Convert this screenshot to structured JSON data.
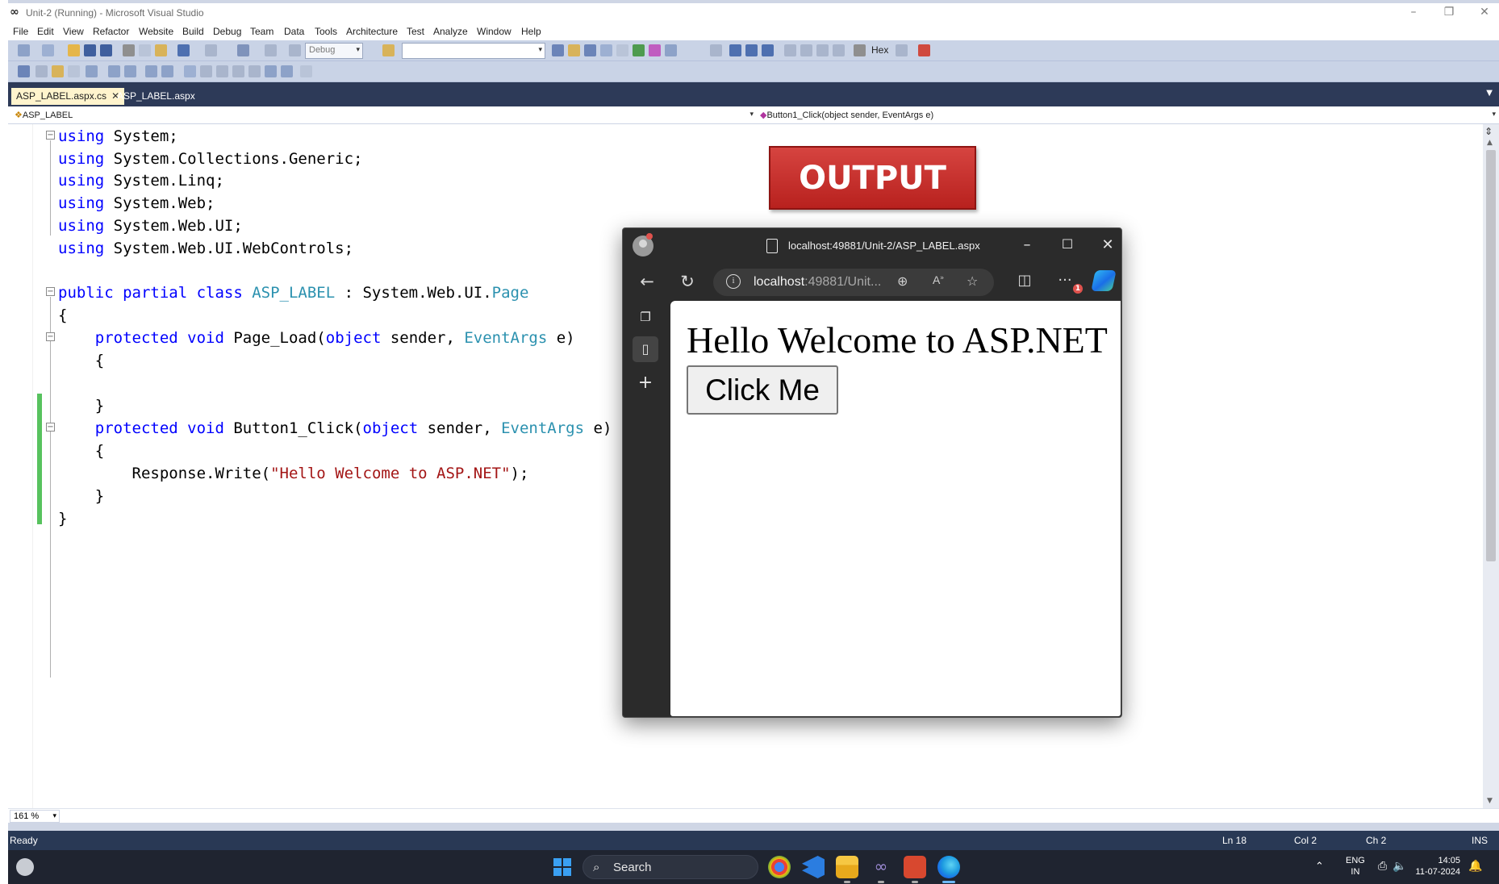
{
  "window": {
    "title": "Unit-2 (Running) - Microsoft Visual Studio",
    "minimize": "–",
    "restore": "❐",
    "close": "✕"
  },
  "menu": [
    "File",
    "Edit",
    "View",
    "Refactor",
    "Website",
    "Build",
    "Debug",
    "Team",
    "Data",
    "Tools",
    "Architecture",
    "Test",
    "Analyze",
    "Window",
    "Help"
  ],
  "toolbar": {
    "config": "Debug",
    "platform": "",
    "hex_label": "Hex"
  },
  "tabs": [
    {
      "label": "ASP_LABEL.aspx.cs",
      "active": true
    },
    {
      "label": "ASP_LABEL.aspx",
      "active": false
    }
  ],
  "navbar": {
    "class_combo": "ASP_LABEL",
    "member_combo": "Button1_Click(object sender, EventArgs e)"
  },
  "code": {
    "line1": "using System;",
    "line2": "using System.Collections.Generic;",
    "line3": "using System.Linq;",
    "line4": "using System.Web;",
    "line5": "using System.Web.UI;",
    "line6": "using System.Web.UI.WebControls;",
    "class_kw": "public partial class ",
    "class_name": "ASP_LABEL",
    "class_sep": " : System.Web.UI.",
    "class_base": "Page",
    "open_brace": "{",
    "m1_kw": "protected void ",
    "m1_name": "Page_Load(",
    "m1_obj": "object",
    "m1_mid": " sender, ",
    "m1_type": "EventArgs",
    "m1_end": " e)",
    "m2_name": "Button1_Click(",
    "resp_start": "Response.Write(",
    "resp_str": "\"Hello Welcome to ASP.NET\"",
    "resp_end": ");",
    "close_brace": "}"
  },
  "zoom": "161 %",
  "status": {
    "state": "Ready",
    "line": "Ln 18",
    "col": "Col 2",
    "ch": "Ch 2",
    "mode": "INS"
  },
  "banner": "OUTPUT",
  "browser": {
    "title": "localhost:49881/Unit-2/ASP_LABEL.aspx",
    "address_host": "localhost",
    "address_rest": ":49881/Unit...",
    "heading": "Hello Welcome to ASP.NET",
    "button_label": "Click Me",
    "notification_count": "1"
  },
  "taskbar": {
    "search_label": "Search",
    "lang_top": "ENG",
    "lang_bottom": "IN",
    "time": "14:05",
    "date": "11-07-2024"
  },
  "colors": {
    "vs_status": "#293955",
    "banner_red": "#c62d29",
    "keyword_blue": "#0000ff",
    "type_teal": "#2b91af",
    "string_red": "#a31515"
  }
}
